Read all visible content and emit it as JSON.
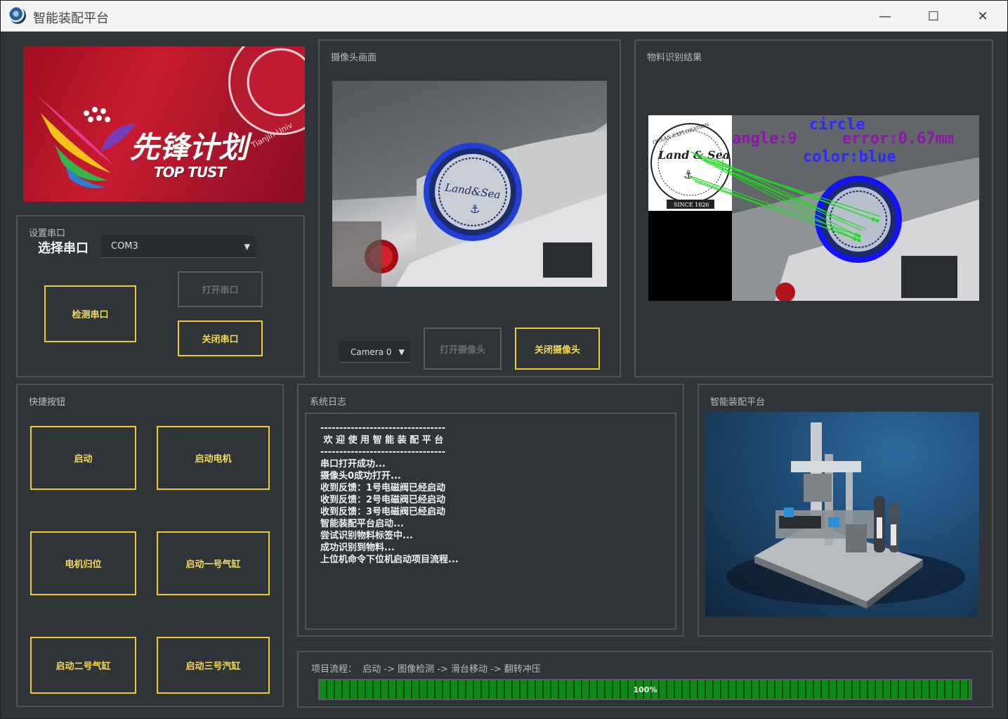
{
  "window": {
    "title": "智能装配平台",
    "controls": {
      "minimize": "—",
      "maximize": "☐",
      "close": "✕"
    }
  },
  "banner": {
    "title": "先锋计划",
    "slogan": "TOP TUST",
    "seal_text": "Tianjin Univ"
  },
  "serial": {
    "group_label": "设置串口",
    "select_label": "选择串口",
    "port_value": "COM3",
    "detect_btn": "检测串口",
    "open_btn": "打开串口",
    "close_btn": "关闭串口"
  },
  "camera": {
    "group_label": "摄像头画面",
    "device_value": "Camera 0",
    "open_btn": "打开摄像头",
    "close_btn": "关闭摄像头"
  },
  "recognition": {
    "group_label": "物料识别结果",
    "overlay": {
      "shape": "circle",
      "angle": "angle:9",
      "error": "error:0.67mm",
      "color": "color:blue"
    },
    "template_text": [
      "OCEAN EXPLORATION",
      "Land & Sea",
      "SINCE 1826"
    ]
  },
  "shortcuts": {
    "group_label": "快捷按钮",
    "buttons": [
      "启动",
      "启动电机",
      "电机归位",
      "启动一号气缸",
      "启动二号气缸",
      "启动三号汽缸"
    ]
  },
  "log": {
    "group_label": "系统日志",
    "lines": [
      "---------------------------------",
      " 欢 迎 使 用 智 能 装 配 平 台",
      "---------------------------------",
      "串口打开成功...",
      "摄像头0成功打开...",
      "收到反馈：1号电磁阀已经启动",
      "收到反馈：2号电磁阀已经启动",
      "收到反馈：3号电磁阀已经启动",
      "智能装配平台启动...",
      "尝试识别物料标签中...",
      "成功识别到物料...",
      "上位机命令下位机启动项目流程..."
    ]
  },
  "platform": {
    "group_label": "智能装配平台"
  },
  "progress": {
    "label": "项目流程：  启动 -> 图像检测 -> 滑台移动 -> 翻转冲压",
    "value": 1.0,
    "text": "100%"
  },
  "colors": {
    "accent_border": "#f0c930",
    "accent_text": "#f3d85a",
    "progress_green": "#0d8a18",
    "overlay_purple": "#8a1aa6",
    "overlay_blue": "#2b2bff"
  }
}
